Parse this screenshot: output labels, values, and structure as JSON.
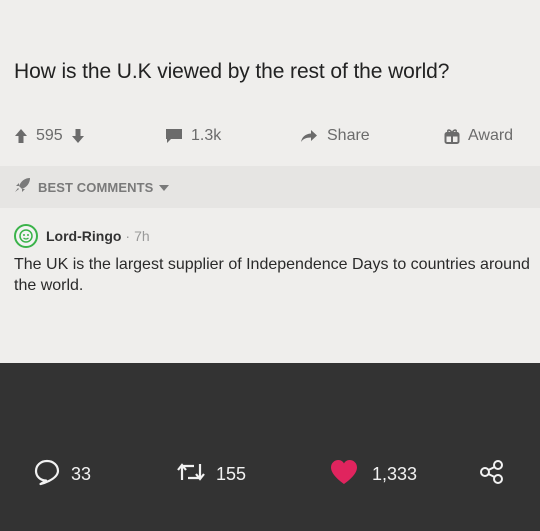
{
  "post": {
    "title": "How is the U.K viewed by the rest of the world?",
    "upvote_count": "595",
    "comment_count": "1.3k",
    "share_label": "Share",
    "award_label": "Award"
  },
  "sort": {
    "label": "BEST COMMENTS"
  },
  "comment": {
    "username": "Lord-Ringo",
    "separator": "·",
    "age": "7h",
    "body": "The UK is the largest supplier of Independence Days to countries around the world."
  },
  "footer": {
    "replies": "33",
    "retweets": "155",
    "likes": "1,333",
    "like_color": "#e0245e"
  }
}
